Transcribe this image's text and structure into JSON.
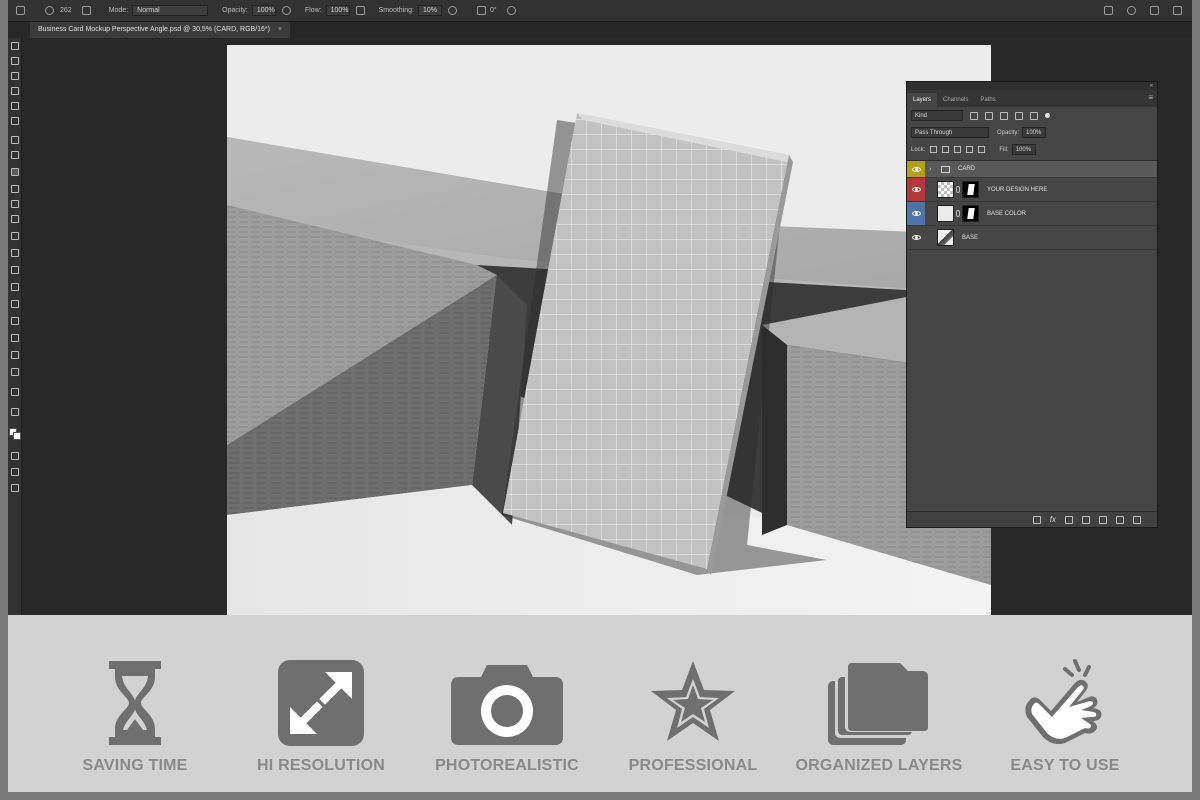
{
  "options_bar": {
    "brush_size": "262",
    "mode_label": "Mode:",
    "mode_value": "Normal",
    "opacity_label": "Opacity:",
    "opacity_value": "100%",
    "flow_label": "Flow:",
    "flow_value": "100%",
    "smoothing_label": "Smoothing:",
    "smoothing_value": "10%",
    "angle_value": "0°"
  },
  "document_tab": {
    "title": "Business Card Mockup Perspective Angle.psd @ 30,5% (CARD, RGB/16*)",
    "close": "×"
  },
  "layers_panel": {
    "collapse": "«",
    "tabs": [
      {
        "label": "Layers",
        "active": true
      },
      {
        "label": "Channels",
        "active": false
      },
      {
        "label": "Paths",
        "active": false
      }
    ],
    "menu": "≡",
    "filter_kind": "Kind",
    "blend_mode": "Pass Through",
    "opacity_label": "Opacity:",
    "opacity_value": "100%",
    "lock_label": "Lock:",
    "fill_label": "Fill:",
    "fill_value": "100%",
    "layers": [
      {
        "name": "CARD",
        "type": "group",
        "color": "#b0a020"
      },
      {
        "name": "YOUR DESIGN HERE",
        "type": "smart",
        "color": "#b03a3a"
      },
      {
        "name": "BASE COLOR",
        "type": "fill",
        "color": "#4f72a8"
      },
      {
        "name": "BASE",
        "type": "image",
        "color": ""
      }
    ],
    "footer_fx": "fx"
  },
  "features": [
    {
      "label": "SAVING TIME",
      "icon": "hourglass-icon"
    },
    {
      "label": "HI RESOLUTION",
      "icon": "expand-arrows-icon"
    },
    {
      "label": "PHOTOREALISTIC",
      "icon": "camera-icon"
    },
    {
      "label": "PROFESSIONAL",
      "icon": "star-icon"
    },
    {
      "label": "ORGANIZED LAYERS",
      "icon": "stacked-layers-icon"
    },
    {
      "label": "EASY TO USE",
      "icon": "pointing-hand-icon"
    }
  ],
  "colors": {
    "icon_gray": "#6f6f6f",
    "label_gray": "#8a8a8a",
    "strip_bg": "#d2d2d2"
  }
}
